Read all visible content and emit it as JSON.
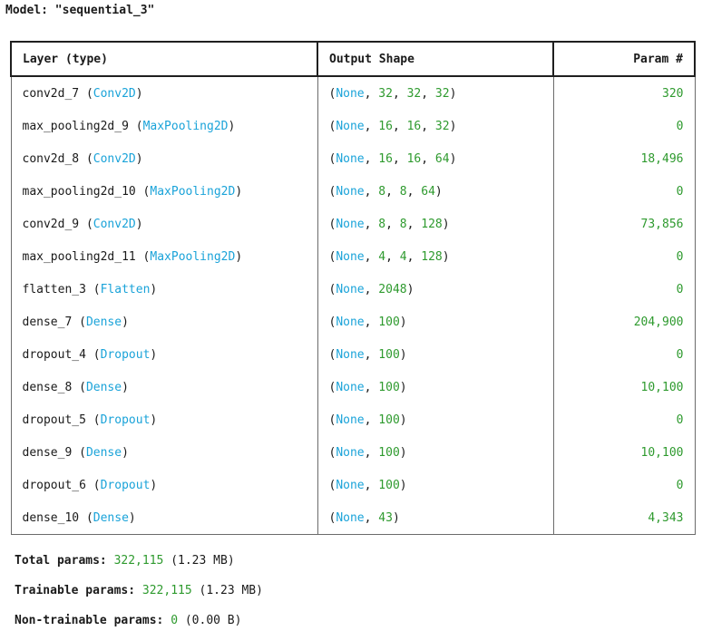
{
  "model": {
    "prefix": "Model: ",
    "name": "\"sequential_3\""
  },
  "table": {
    "headers": {
      "layer": "Layer (type)",
      "output": "Output Shape",
      "params": "Param #"
    },
    "rows": [
      {
        "name": "conv2d_7",
        "type": "Conv2D",
        "shape": [
          "None",
          "32",
          "32",
          "32"
        ],
        "params": "320"
      },
      {
        "name": "max_pooling2d_9",
        "type": "MaxPooling2D",
        "shape": [
          "None",
          "16",
          "16",
          "32"
        ],
        "params": "0"
      },
      {
        "name": "conv2d_8",
        "type": "Conv2D",
        "shape": [
          "None",
          "16",
          "16",
          "64"
        ],
        "params": "18,496"
      },
      {
        "name": "max_pooling2d_10",
        "type": "MaxPooling2D",
        "shape": [
          "None",
          "8",
          "8",
          "64"
        ],
        "params": "0"
      },
      {
        "name": "conv2d_9",
        "type": "Conv2D",
        "shape": [
          "None",
          "8",
          "8",
          "128"
        ],
        "params": "73,856"
      },
      {
        "name": "max_pooling2d_11",
        "type": "MaxPooling2D",
        "shape": [
          "None",
          "4",
          "4",
          "128"
        ],
        "params": "0"
      },
      {
        "name": "flatten_3",
        "type": "Flatten",
        "shape": [
          "None",
          "2048"
        ],
        "params": "0"
      },
      {
        "name": "dense_7",
        "type": "Dense",
        "shape": [
          "None",
          "100"
        ],
        "params": "204,900"
      },
      {
        "name": "dropout_4",
        "type": "Dropout",
        "shape": [
          "None",
          "100"
        ],
        "params": "0"
      },
      {
        "name": "dense_8",
        "type": "Dense",
        "shape": [
          "None",
          "100"
        ],
        "params": "10,100"
      },
      {
        "name": "dropout_5",
        "type": "Dropout",
        "shape": [
          "None",
          "100"
        ],
        "params": "0"
      },
      {
        "name": "dense_9",
        "type": "Dense",
        "shape": [
          "None",
          "100"
        ],
        "params": "10,100"
      },
      {
        "name": "dropout_6",
        "type": "Dropout",
        "shape": [
          "None",
          "100"
        ],
        "params": "0"
      },
      {
        "name": "dense_10",
        "type": "Dense",
        "shape": [
          "None",
          "43"
        ],
        "params": "4,343"
      }
    ]
  },
  "totals": {
    "total": {
      "label": "Total params: ",
      "value": "322,115",
      "size": " (1.23 MB)"
    },
    "trainable": {
      "label": "Trainable params: ",
      "value": "322,115",
      "size": " (1.23 MB)"
    },
    "non_trainable": {
      "label": "Non-trainable params: ",
      "value": "0",
      "size": " (0.00 B)"
    }
  },
  "colors": {
    "type_name": "#1aa3d9",
    "none_keyword": "#1aa3d9",
    "number": "#2e9a2e",
    "text": "#1a1a1a",
    "border": "#1f1f1f"
  }
}
